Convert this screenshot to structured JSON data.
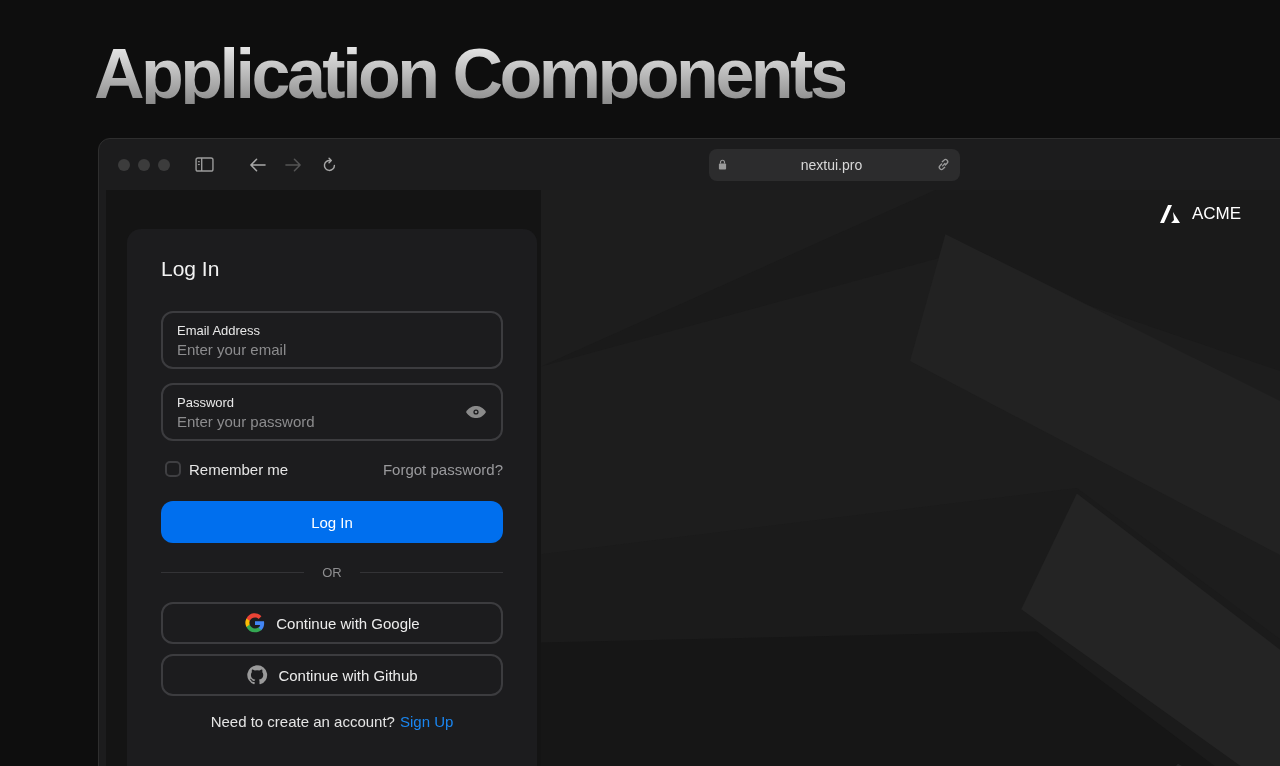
{
  "heading": "Application Components",
  "browser": {
    "url": "nextui.pro",
    "back_disabled": false,
    "forward_disabled": true
  },
  "brand": {
    "name": "ACME"
  },
  "login": {
    "title": "Log In",
    "fields": [
      {
        "kind": "email",
        "label": "Email Address",
        "placeholder": "Enter your email"
      },
      {
        "kind": "password",
        "label": "Password",
        "placeholder": "Enter your password"
      }
    ],
    "remember": {
      "label": "Remember me",
      "checked": false
    },
    "forgot": "Forgot password?",
    "submit": "Log In",
    "divider": "OR",
    "providers": [
      {
        "kind": "google",
        "label": "Continue with Google"
      },
      {
        "kind": "github",
        "label": "Continue with Github"
      }
    ],
    "signup": {
      "text": "Need to create an account?",
      "link": "Sign Up"
    }
  }
}
